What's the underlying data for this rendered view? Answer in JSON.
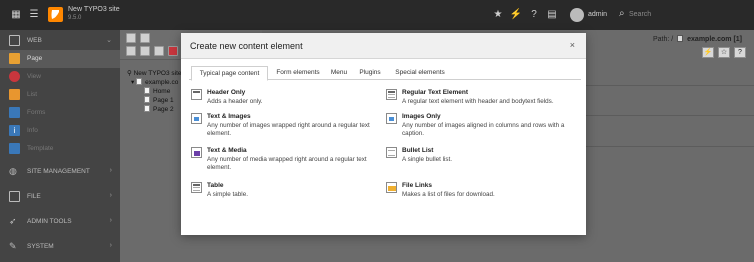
{
  "topbar": {
    "site_name": "New TYPO3 site",
    "site_version": "9.5.0",
    "user": "admin",
    "search_label": "Search"
  },
  "module_menu": {
    "web": "WEB",
    "page": "Page",
    "view": "View",
    "list": "List",
    "forms": "Forms",
    "info": "Info",
    "template": "Template",
    "site_management": "SITE MANAGEMENT",
    "file": "FILE",
    "admin_tools": "ADMIN TOOLS",
    "system": "SYSTEM"
  },
  "tree": {
    "root": "New TYPO3 site",
    "domain": "example.co",
    "home": "Home",
    "page1": "Page 1",
    "page2": "Page 2"
  },
  "path": {
    "prefix": "Path: /",
    "page": "example.com [1]"
  },
  "modal": {
    "title": "Create new content element",
    "close": "×",
    "tabs": [
      {
        "label": "Typical page content"
      },
      {
        "label": "Form elements"
      },
      {
        "label": "Menu"
      },
      {
        "label": "Plugins"
      },
      {
        "label": "Special elements"
      }
    ],
    "elements": [
      {
        "title": "Header Only",
        "desc": "Adds a header only."
      },
      {
        "title": "Regular Text Element",
        "desc": "A regular text element with header and bodytext fields."
      },
      {
        "title": "Text & Images",
        "desc": "Any number of images wrapped right around a regular text element."
      },
      {
        "title": "Images Only",
        "desc": "Any number of images aligned in columns and rows with a caption."
      },
      {
        "title": "Text & Media",
        "desc": "Any number of media wrapped right around a regular text element."
      },
      {
        "title": "Bullet List",
        "desc": "A single bullet list."
      },
      {
        "title": "Table",
        "desc": "A simple table."
      },
      {
        "title": "File Links",
        "desc": "Makes a list of files for download."
      }
    ]
  },
  "colors": {
    "typo3_orange": "#ff8700",
    "module_page": "#e8a032",
    "module_view": "#c8363d",
    "module_list": "#e8962f",
    "module_forms": "#3a78b9",
    "module_info": "#3a78b9",
    "module_template": "#3a78b9"
  }
}
